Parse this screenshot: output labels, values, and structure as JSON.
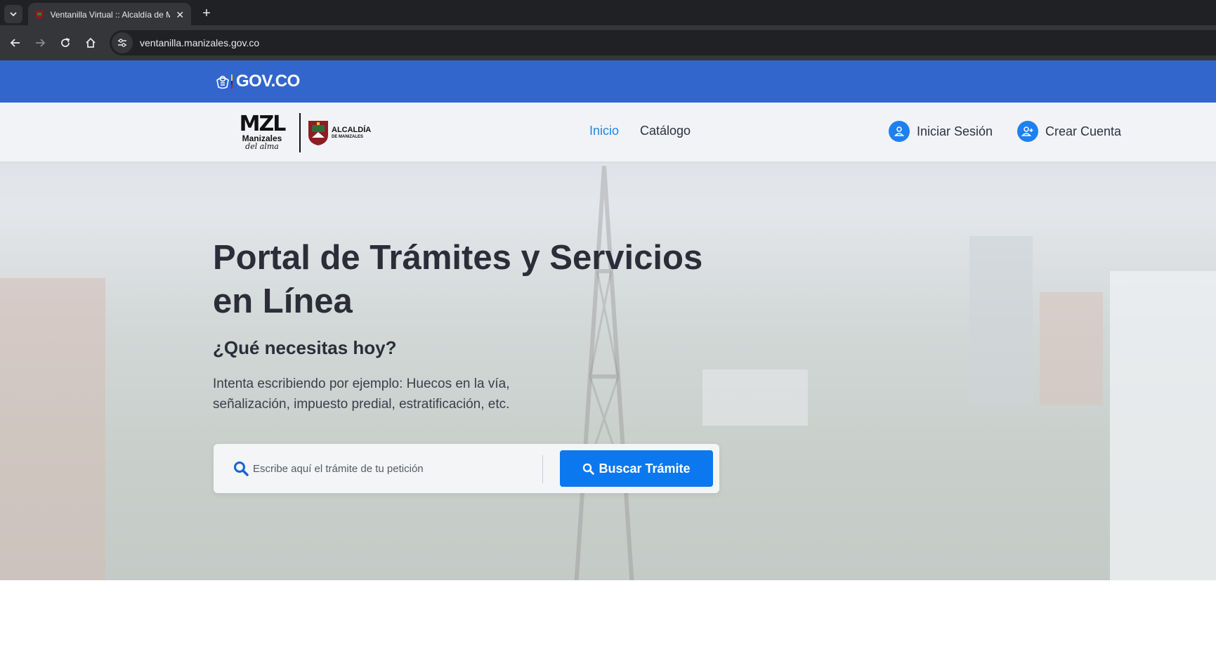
{
  "browser": {
    "tab_title": "Ventanilla Virtual :: Alcaldía de Manizales",
    "url": "ventanilla.manizales.gov.co"
  },
  "govbar": {
    "logo_text": "GOV.CO"
  },
  "brand": {
    "mzl": "MZL",
    "mzl_sub": "Manizales",
    "mzl_script": "del alma",
    "alcaldia_line1": "ALCALDÍA",
    "alcaldia_line2": "DE MANIZALES"
  },
  "nav": {
    "items": [
      {
        "label": "Inicio",
        "active": true
      },
      {
        "label": "Catálogo",
        "active": false
      }
    ],
    "login_label": "Iniciar Sesión",
    "register_label": "Crear Cuenta"
  },
  "hero": {
    "title": "Portal de Trámites y Servicios en Línea",
    "subtitle": "¿Qué necesitas hoy?",
    "description": "Intenta escribiendo por ejemplo: Huecos en la vía, señalización, impuesto predial, estratificación, etc."
  },
  "search": {
    "placeholder": "Escribe aquí el trámite de tu petición",
    "value": "",
    "button_label": "Buscar Trámite"
  },
  "colors": {
    "govbar": "#3366cc",
    "accent": "#0b78f0",
    "active_link": "#1e88e5"
  }
}
